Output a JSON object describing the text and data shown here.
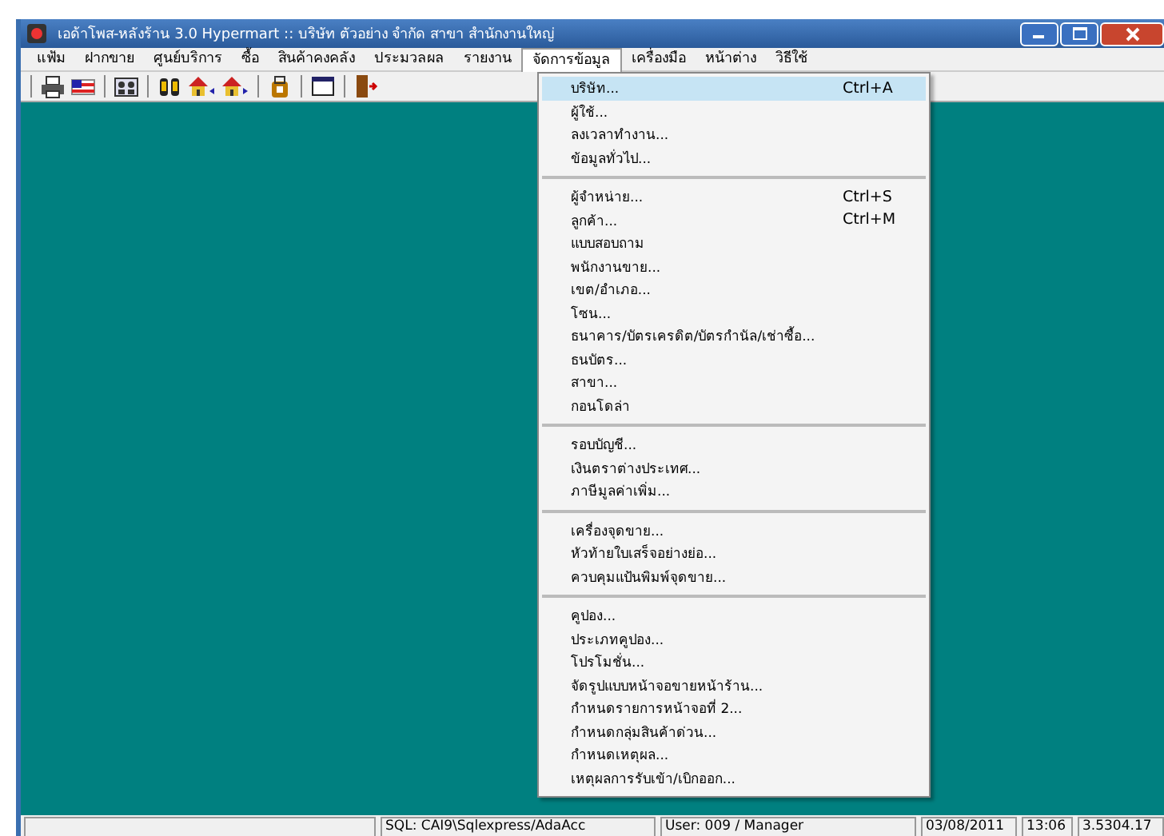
{
  "window": {
    "title": "เอด้าโพส-หลังร้าน 3.0 Hypermart :: บริษัท ตัวอย่าง จำกัด สาขา สำนักงานใหญ่"
  },
  "menu_bar": [
    {
      "label": "แฟ้ม",
      "selected": false
    },
    {
      "label": "ฝากขาย",
      "selected": false
    },
    {
      "label": "ศูนย์บริการ",
      "selected": false
    },
    {
      "label": "ซื้อ",
      "selected": false
    },
    {
      "label": "สินค้าคงคลัง",
      "selected": false
    },
    {
      "label": "ประมวลผล",
      "selected": false
    },
    {
      "label": "รายงาน",
      "selected": false
    },
    {
      "label": "จัดการข้อมูล",
      "selected": true
    },
    {
      "label": "เครื่องมือ",
      "selected": false
    },
    {
      "label": "หน้าต่าง",
      "selected": false
    },
    {
      "label": "วิธีใช้",
      "selected": false
    }
  ],
  "toolbar": [
    {
      "kind": "printer"
    },
    {
      "kind": "flag"
    },
    {
      "kind": "users"
    },
    {
      "kind": "binoculars"
    },
    {
      "kind": "home-back"
    },
    {
      "kind": "home-forward"
    },
    {
      "kind": "bag"
    },
    {
      "kind": "window"
    },
    {
      "kind": "exit"
    }
  ],
  "dropdown": [
    {
      "kind": "item",
      "label": "บริษัท...",
      "shortcut": "Ctrl+A",
      "selected": true
    },
    {
      "kind": "item",
      "label": "ผู้ใช้...",
      "selected": false
    },
    {
      "kind": "item",
      "label": "ลงเวลาทำงาน...",
      "selected": false
    },
    {
      "kind": "item",
      "label": "ข้อมูลทั่วไป...",
      "selected": false
    },
    {
      "kind": "separator"
    },
    {
      "kind": "item",
      "label": "ผู้จำหน่าย...",
      "shortcut": "Ctrl+S",
      "selected": false
    },
    {
      "kind": "item",
      "label": "ลูกค้า...",
      "shortcut": "Ctrl+M",
      "selected": false
    },
    {
      "kind": "item",
      "label": "แบบสอบถาม",
      "selected": false
    },
    {
      "kind": "item",
      "label": "พนักงานขาย...",
      "selected": false
    },
    {
      "kind": "item",
      "label": "เขต/อำเภอ...",
      "selected": false
    },
    {
      "kind": "item",
      "label": "โซน...",
      "selected": false
    },
    {
      "kind": "item",
      "label": "ธนาคาร/บัตรเครดิต/บัตรกำนัล/เช่าซื้อ...",
      "selected": false
    },
    {
      "kind": "item",
      "label": "ธนบัตร...",
      "selected": false
    },
    {
      "kind": "item",
      "label": "สาขา...",
      "selected": false
    },
    {
      "kind": "item",
      "label": "กอนโดล่า",
      "selected": false
    },
    {
      "kind": "separator"
    },
    {
      "kind": "item",
      "label": "รอบบัญชี...",
      "selected": false
    },
    {
      "kind": "item",
      "label": "เงินตราต่างประเทศ...",
      "selected": false
    },
    {
      "kind": "item",
      "label": "ภาษีมูลค่าเพิ่ม...",
      "selected": false
    },
    {
      "kind": "separator"
    },
    {
      "kind": "item",
      "label": "เครื่องจุดขาย...",
      "selected": false
    },
    {
      "kind": "item",
      "label": "หัวท้ายใบเสร็จอย่างย่อ...",
      "selected": false
    },
    {
      "kind": "item",
      "label": "ควบคุมแป้นพิมพ์จุดขาย...",
      "selected": false
    },
    {
      "kind": "separator"
    },
    {
      "kind": "item",
      "label": "คูปอง...",
      "selected": false
    },
    {
      "kind": "item",
      "label": "ประเภทคูปอง...",
      "selected": false
    },
    {
      "kind": "item",
      "label": "โปรโมชั่น...",
      "selected": false
    },
    {
      "kind": "item",
      "label": "จัดรูปแบบหน้าจอขายหน้าร้าน...",
      "selected": false
    },
    {
      "kind": "item",
      "label": "กำหนดรายการหน้าจอที่ 2...",
      "selected": false
    },
    {
      "kind": "item",
      "label": "กำหนดกลุ่มสินค้าด่วน...",
      "selected": false
    },
    {
      "kind": "item",
      "label": "กำหนดเหตุผล...",
      "selected": false
    },
    {
      "kind": "item",
      "label": "เหตุผลการรับเข้า/เบิกออก...",
      "selected": false
    }
  ],
  "status_bar": [
    "SQL: CAI9\\Sqlexpress/AdaAcc",
    "User: 009 / Manager",
    "03/08/2011",
    "13:06",
    "3.5304.17"
  ]
}
